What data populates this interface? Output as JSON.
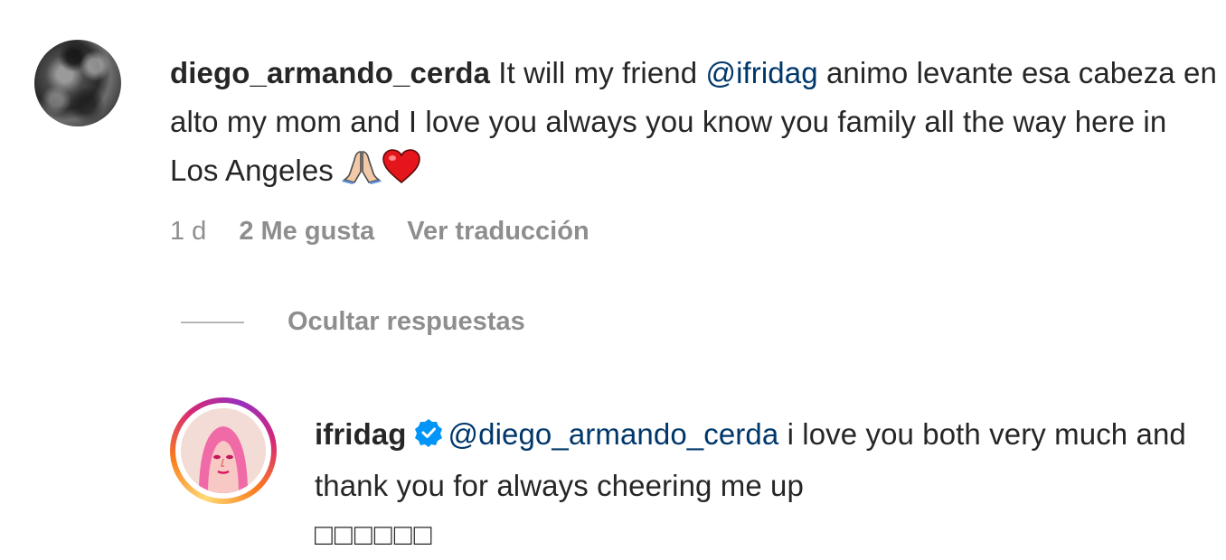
{
  "comment": {
    "username": "diego_armando_cerda",
    "text_before_mention": " It will my friend ",
    "mention": "@ifridag",
    "text_after_mention": " animo levante esa cabeza en alto my mom and I love you always you know you family all the way here in Los Angeles ",
    "emoji_icons": [
      "folded-hands-icon",
      "red-heart-icon"
    ],
    "time": "1 d",
    "likes": "2 Me gusta",
    "translate": "Ver traducción"
  },
  "replies_toggle": {
    "label": "Ocultar respuestas"
  },
  "reply": {
    "username": "ifridag",
    "verified": true,
    "mention": "@diego_armando_cerda",
    "text": " i love you both very much and thank you for always cheering me up",
    "unrendered_glyphs": "□□□□□□"
  },
  "colors": {
    "mention": "#00376b",
    "meta_gray": "#8e8e8e",
    "verified_blue": "#0095f6"
  }
}
